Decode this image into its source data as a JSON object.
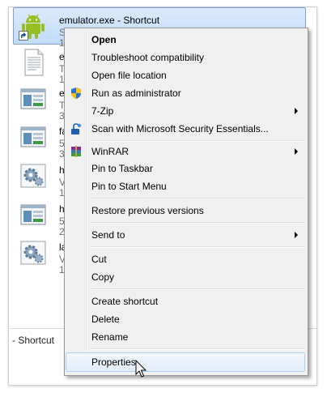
{
  "files": [
    {
      "name": "emulator.exe - Shortcut",
      "sub": "S\n1",
      "icon": "android-icon",
      "selected": true
    },
    {
      "name": "e",
      "sub": "T\n1",
      "icon": "text-file-icon"
    },
    {
      "name": "e",
      "sub": "T\n3",
      "icon": "window-app-icon"
    },
    {
      "name": "fa",
      "sub": "5\n3",
      "icon": "window-app-icon"
    },
    {
      "name": "h",
      "sub": "V\n1",
      "icon": "gear-app-icon"
    },
    {
      "name": "h",
      "sub": "5\n2",
      "icon": "window-app-icon"
    },
    {
      "name": "la",
      "sub": "V\n1",
      "icon": "gear-app-icon"
    }
  ],
  "status_label": "- Shortcut",
  "menu": {
    "open": "Open",
    "troubleshoot": "Troubleshoot compatibility",
    "open_location": "Open file location",
    "run_admin": "Run as administrator",
    "sevenzip": "7-Zip",
    "scan": "Scan with Microsoft Security Essentials...",
    "winrar": "WinRAR",
    "pin_taskbar": "Pin to Taskbar",
    "pin_start": "Pin to Start Menu",
    "restore": "Restore previous versions",
    "send_to": "Send to",
    "cut": "Cut",
    "copy": "Copy",
    "create_shortcut": "Create shortcut",
    "delete": "Delete",
    "rename": "Rename",
    "properties": "Properties"
  }
}
